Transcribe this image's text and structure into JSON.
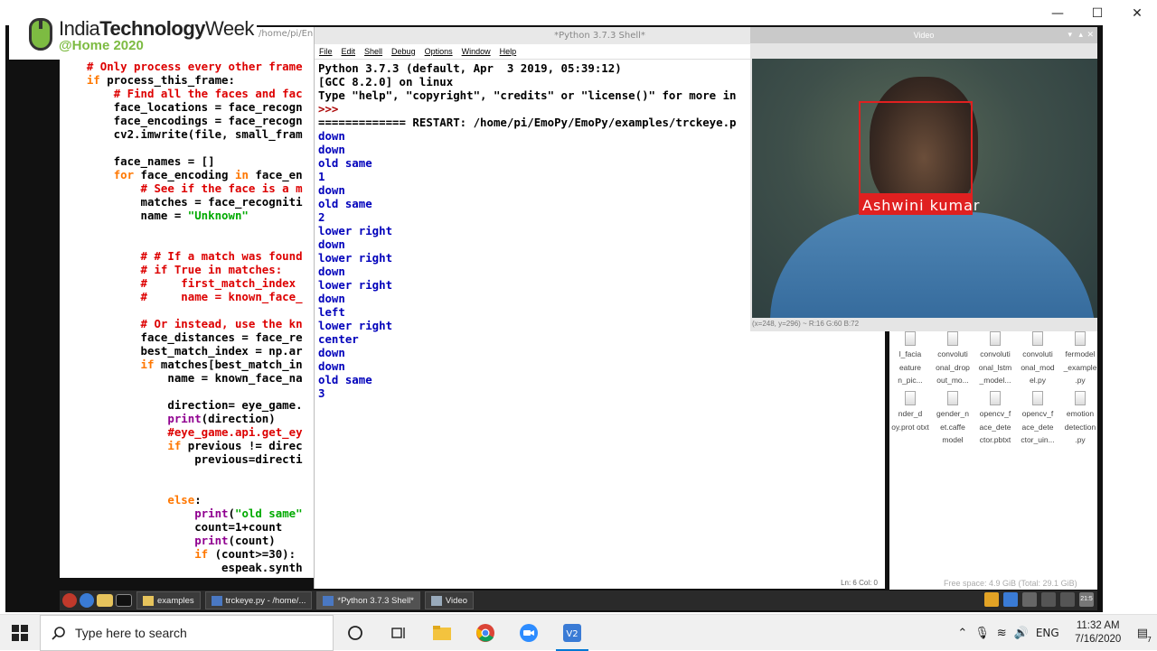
{
  "host": {
    "controls": [
      "—",
      "☐",
      "✕"
    ]
  },
  "logo": {
    "line1_a": "India",
    "line1_b": "Technology",
    "line1_c": "Week",
    "line2": "@Home 2020"
  },
  "editor": {
    "title_fragment": "/home/pi/En",
    "lines": [
      [
        {
          "t": "    "
        },
        {
          "t": "# Only process every other frame",
          "c": "cm"
        }
      ],
      [
        {
          "t": "    "
        },
        {
          "t": "if",
          "c": "kw"
        },
        {
          "t": " process_this_frame:"
        }
      ],
      [
        {
          "t": "        "
        },
        {
          "t": "# Find all the faces and fac",
          "c": "cm"
        }
      ],
      [
        {
          "t": "        face_locations = face_recogn"
        }
      ],
      [
        {
          "t": "        face_encodings = face_recogn"
        }
      ],
      [
        {
          "t": "        cv2.imwrite(file, small_fram"
        }
      ],
      [
        {
          "t": ""
        }
      ],
      [
        {
          "t": "        face_names = []"
        }
      ],
      [
        {
          "t": "        "
        },
        {
          "t": "for",
          "c": "kw"
        },
        {
          "t": " face_encoding "
        },
        {
          "t": "in",
          "c": "kw"
        },
        {
          "t": " face_en"
        }
      ],
      [
        {
          "t": "            "
        },
        {
          "t": "# See if the face is a m",
          "c": "cm"
        }
      ],
      [
        {
          "t": "            matches = face_recogniti"
        }
      ],
      [
        {
          "t": "            name = "
        },
        {
          "t": "\"Unknown\"",
          "c": "st"
        }
      ],
      [
        {
          "t": ""
        }
      ],
      [
        {
          "t": ""
        }
      ],
      [
        {
          "t": "            "
        },
        {
          "t": "# # If a match was found",
          "c": "cm"
        }
      ],
      [
        {
          "t": "            "
        },
        {
          "t": "# if True in matches:",
          "c": "cm"
        }
      ],
      [
        {
          "t": "            "
        },
        {
          "t": "#     first_match_index",
          "c": "cm"
        }
      ],
      [
        {
          "t": "            "
        },
        {
          "t": "#     name = known_face_",
          "c": "cm"
        }
      ],
      [
        {
          "t": ""
        }
      ],
      [
        {
          "t": "            "
        },
        {
          "t": "# Or instead, use the kn",
          "c": "cm"
        }
      ],
      [
        {
          "t": "            face_distances = face_re"
        }
      ],
      [
        {
          "t": "            best_match_index = np.ar"
        }
      ],
      [
        {
          "t": "            "
        },
        {
          "t": "if",
          "c": "kw"
        },
        {
          "t": " matches[best_match_in"
        }
      ],
      [
        {
          "t": "                name = known_face_na"
        }
      ],
      [
        {
          "t": ""
        }
      ],
      [
        {
          "t": "                direction= eye_game."
        }
      ],
      [
        {
          "t": "                "
        },
        {
          "t": "print",
          "c": "bi"
        },
        {
          "t": "(direction)"
        }
      ],
      [
        {
          "t": "                "
        },
        {
          "t": "#eye_game.api.get_ey",
          "c": "cm"
        }
      ],
      [
        {
          "t": "                "
        },
        {
          "t": "if",
          "c": "kw"
        },
        {
          "t": " previous != direc"
        }
      ],
      [
        {
          "t": "                    previous=directi"
        }
      ],
      [
        {
          "t": ""
        }
      ],
      [
        {
          "t": ""
        }
      ],
      [
        {
          "t": "                "
        },
        {
          "t": "else",
          "c": "kw"
        },
        {
          "t": ":"
        }
      ],
      [
        {
          "t": "                    "
        },
        {
          "t": "print",
          "c": "bi"
        },
        {
          "t": "("
        },
        {
          "t": "\"old same\"",
          "c": "st"
        }
      ],
      [
        {
          "t": "                    count=1+count"
        }
      ],
      [
        {
          "t": "                    "
        },
        {
          "t": "print",
          "c": "bi"
        },
        {
          "t": "(count)"
        }
      ],
      [
        {
          "t": "                    "
        },
        {
          "t": "if",
          "c": "kw"
        },
        {
          "t": " (count>=30):"
        }
      ],
      [
        {
          "t": "                        espeak.synth"
        }
      ]
    ]
  },
  "shell": {
    "title": "*Python 3.7.3 Shell*",
    "menu": [
      "File",
      "Edit",
      "Shell",
      "Debug",
      "Options",
      "Window",
      "Help"
    ],
    "output": [
      {
        "t": "Python 3.7.3 (default, Apr  3 2019, 05:39:12)",
        "c": "hdr"
      },
      {
        "t": "[GCC 8.2.0] on linux",
        "c": "hdr"
      },
      {
        "t": "Type \"help\", \"copyright\", \"credits\" or \"license()\" for more in",
        "c": "hdr"
      },
      {
        "t": ">>> ",
        "c": "prompt"
      },
      {
        "t": "============= RESTART: /home/pi/EmoPy/EmoPy/examples/trckeye.p",
        "c": "hdr"
      },
      {
        "t": "down",
        "c": "out"
      },
      {
        "t": "down",
        "c": "out"
      },
      {
        "t": "old same",
        "c": "out"
      },
      {
        "t": "1",
        "c": "out"
      },
      {
        "t": "down",
        "c": "out"
      },
      {
        "t": "old same",
        "c": "out"
      },
      {
        "t": "2",
        "c": "out"
      },
      {
        "t": "lower right",
        "c": "out"
      },
      {
        "t": "down",
        "c": "out"
      },
      {
        "t": "lower right",
        "c": "out"
      },
      {
        "t": "down",
        "c": "out"
      },
      {
        "t": "lower right",
        "c": "out"
      },
      {
        "t": "down",
        "c": "out"
      },
      {
        "t": "left",
        "c": "out"
      },
      {
        "t": "lower right",
        "c": "out"
      },
      {
        "t": "center",
        "c": "out"
      },
      {
        "t": "down",
        "c": "out"
      },
      {
        "t": "down",
        "c": "out"
      },
      {
        "t": "old same",
        "c": "out"
      },
      {
        "t": "3",
        "c": "out"
      }
    ],
    "status": "Ln: 6   Col: 0"
  },
  "video": {
    "title": "Video",
    "face_label": "Ashwini kumar",
    "status": "(x=248, y=296) ~ R:16 G:60 B:72"
  },
  "files": {
    "items": [
      {
        "name": "l_facia eature n_pic..."
      },
      {
        "name": "convoluti onal_drop out_mo..."
      },
      {
        "name": "convoluti onal_lstm _model..."
      },
      {
        "name": "convoluti onal_mod el.py"
      },
      {
        "name": "fermodel _example .py"
      },
      {
        "name": "nder_d oy.prot otxt"
      },
      {
        "name": "gender_n et.caffe model"
      },
      {
        "name": "opencv_f ace_dete ctor.pbtxt"
      },
      {
        "name": "opencv_f ace_dete ctor_uin..."
      },
      {
        "name": "emotion detection .py"
      }
    ],
    "status": "Free space: 4.9 GiB (Total: 29.1 GiB)"
  },
  "rpi_taskbar": {
    "tasks": [
      {
        "label": "examples"
      },
      {
        "label": "trckeye.py - /home/..."
      },
      {
        "label": "*Python 3.7.3 Shell*"
      },
      {
        "label": "Video"
      }
    ],
    "tray_time": "21:5"
  },
  "win_taskbar": {
    "search_placeholder": "Type here to search",
    "lang": "ENG",
    "time": "11:32 AM",
    "date": "7/16/2020",
    "notification_count": "7"
  }
}
